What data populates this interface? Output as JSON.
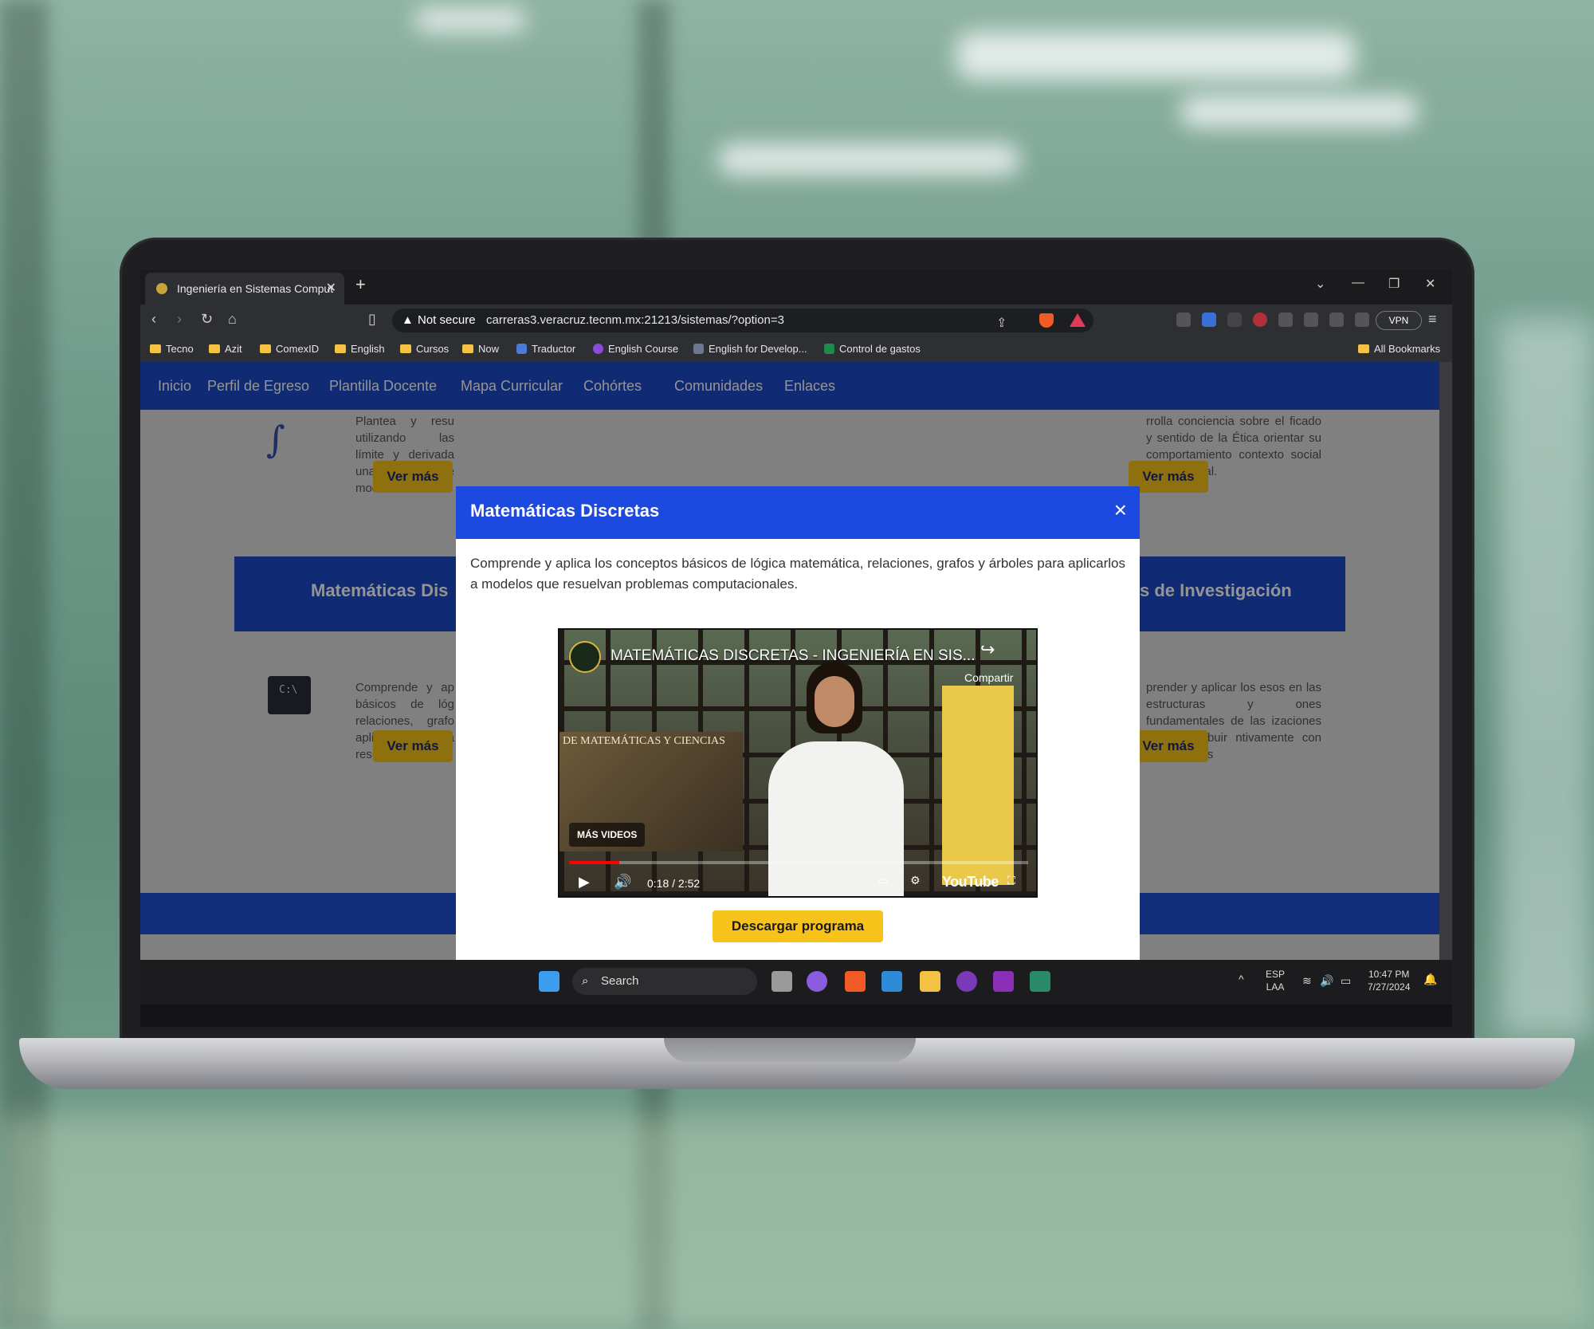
{
  "browser": {
    "tab_title": "Ingeniería en Sistemas Comput",
    "new_tab": "+",
    "close_tab": "✕",
    "security_label": "Not secure",
    "url": "carreras3.veracruz.tecnm.mx:21213/sistemas/?option=3",
    "vpn_label": "VPN",
    "bookmarks": [
      "Tecno",
      "Azit",
      "ComexID",
      "English",
      "Cursos",
      "Now",
      "Traductor",
      "English Course",
      "English for Develop...",
      "Control de gastos"
    ],
    "all_bookmarks": "All Bookmarks"
  },
  "site": {
    "nav": [
      "Inicio",
      "Perfil de Egreso",
      "Plantilla Docente",
      "Mapa Curricular",
      "Cohórtes",
      "Comunidades",
      "Enlaces"
    ],
    "card1_text": "Plantea y resu utilizando las límite y derivada una variable pa de modelos",
    "card2_text": "rrolla conciencia sobre el ficado y sentido de la Ética orientar su comportamiento contexto social y profesional.",
    "section_left": "Matemáticas Dis",
    "section_right": "s de Investigación",
    "card3_text": "Comprende y ap básicos de lóg relaciones, grafo aplicarlos a resuelvan",
    "card4_text": "prender y aplicar los esos en las estructuras y ones fundamentales de las izaciones para contribuir ntivamente con los procesos",
    "ver_mas": "Ver más"
  },
  "modal": {
    "title": "Matemáticas Discretas",
    "description": "Comprende y aplica los conceptos básicos de lógica matemática, relaciones, grafos y árboles para aplicarlos a modelos que resuelvan problemas computacionales.",
    "download_button": "Descargar programa",
    "video": {
      "title": "MATEMÁTICAS DISCRETAS - INGENIERÍA EN SIS...",
      "share_label": "Compartir",
      "board_text": "DE MATEMÁTICAS Y CIENCIAS",
      "more_videos": "MÁS VIDEOS",
      "time": "0:18 / 2:52",
      "progress": 0.11,
      "brand": "YouTube"
    }
  },
  "taskbar": {
    "search_placeholder": "Search",
    "lang_top": "ESP",
    "lang_bottom": "LAA",
    "time": "10:47 PM",
    "date": "7/27/2024"
  }
}
